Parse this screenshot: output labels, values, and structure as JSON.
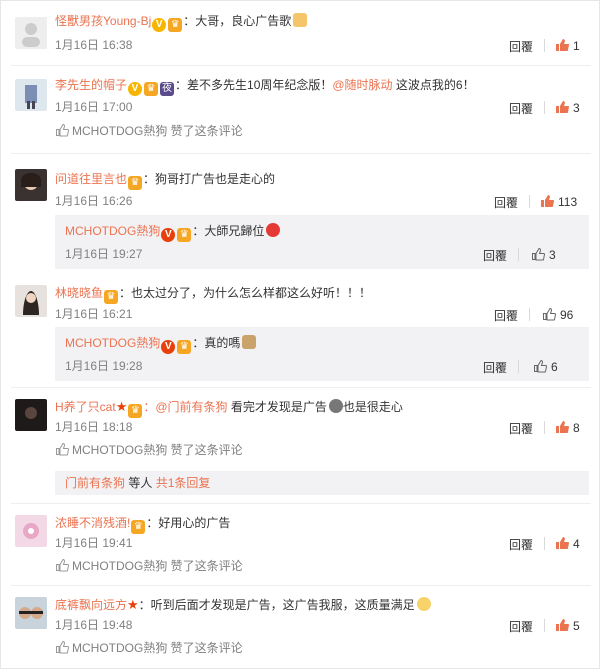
{
  "comments": [
    {
      "user": "怪獸男孩Young-Bj",
      "text": "：大哥，良心广告歌",
      "time": "1月16日 16:38",
      "reply": "回覆",
      "likes": "1",
      "liked": true
    },
    {
      "user": "李先生的帽子",
      "text": "：差不多先生10周年纪念版！",
      "mention": "@随时脉动",
      "text2": " 这波点我的6！",
      "time": "1月16日 17:00",
      "reply": "回覆",
      "likes": "3",
      "liked": true,
      "liked_by": "MCHOTDOG熱狗 赞了这条评论"
    },
    {
      "user": "问道往里言也",
      "text": "：狗哥打广告也是走心的",
      "time": "1月16日 16:26",
      "reply": "回覆",
      "likes": "113",
      "liked": true,
      "nested": {
        "user": "MCHOTDOG熱狗",
        "text": "：大師兄歸位",
        "time": "1月16日 19:27",
        "reply": "回覆",
        "likes": "3"
      }
    },
    {
      "user": "林晓晓鱼",
      "text": "：也太过分了，为什么怎么样都这么好听！！！",
      "time": "1月16日 16:21",
      "reply": "回覆",
      "likes": "96",
      "liked": false,
      "nested": {
        "user": "MCHOTDOG熱狗",
        "text": "：真的嗎",
        "time": "1月16日 19:28",
        "reply": "回覆",
        "likes": "6"
      }
    },
    {
      "user": "H养了只cat",
      "mention": "：@门前有条狗",
      "text": " 看完才发现是广告",
      "text2": "也是很走心",
      "time": "1月16日 18:18",
      "reply": "回覆",
      "likes": "8",
      "liked": true,
      "liked_by": "MCHOTDOG熱狗 赞了这条评论",
      "more_user": "门前有条狗",
      "more_text": " 等人 ",
      "more_link": "共1条回复"
    },
    {
      "user": "浓睡不消残酒!",
      "text": "：好用心的广告",
      "time": "1月16日 19:41",
      "reply": "回覆",
      "likes": "4",
      "liked": true,
      "liked_by": "MCHOTDOG熱狗 赞了这条评论"
    },
    {
      "user": "底裤飘向远方",
      "text": "：听到后面才发现是广告，这广告我服，这质量满足",
      "time": "1月16日 19:48",
      "reply": "回覆",
      "likes": "5",
      "liked": true,
      "liked_by": "MCHOTDOG熱狗 赞了这条评论"
    }
  ],
  "colors": {
    "username": "#eb7350",
    "liked_thumb": "#eb7350",
    "nested_bg": "#f2f2f5",
    "meta": "#808080"
  }
}
